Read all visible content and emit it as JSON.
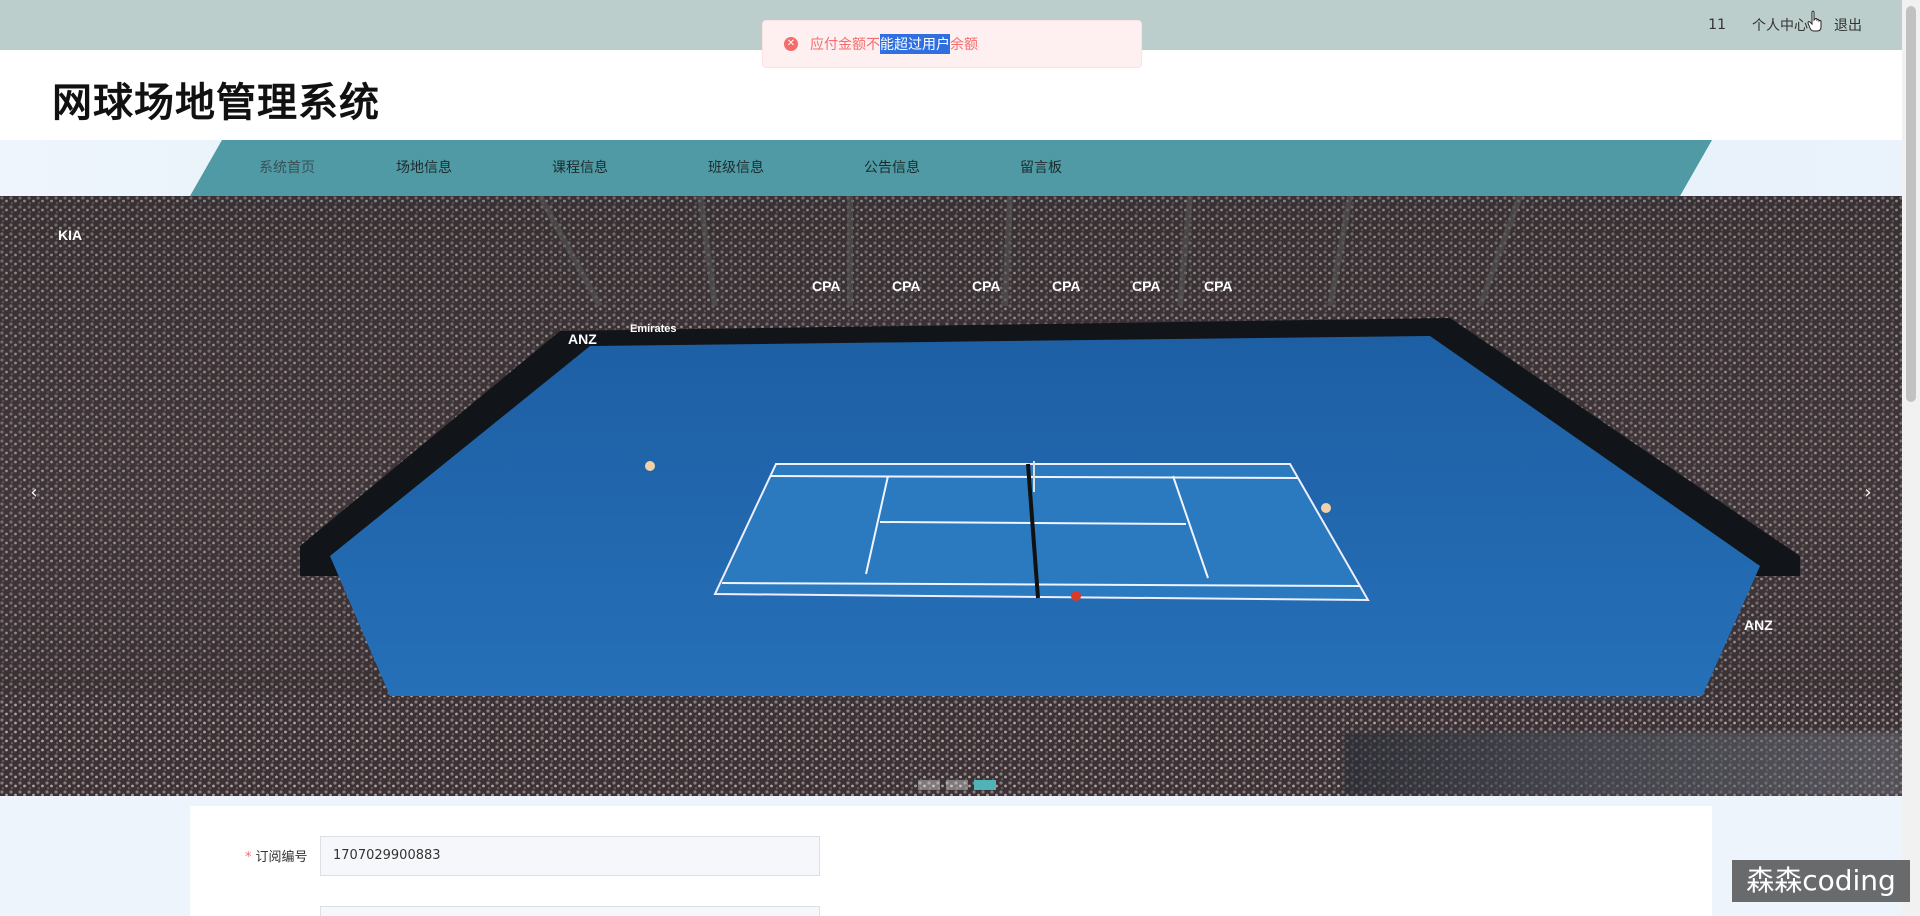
{
  "topbar": {
    "user_id": "11",
    "profile_label": "个人中心",
    "logout_label": "退出"
  },
  "toast": {
    "text_before": "应付金额不",
    "text_selected": "能超过用户",
    "text_after": "余额",
    "icon": "error-circle-icon"
  },
  "header": {
    "title": "网球场地管理系统"
  },
  "nav": {
    "items": [
      {
        "label": "系统首页"
      },
      {
        "label": "场地信息"
      },
      {
        "label": "课程信息"
      },
      {
        "label": "班级信息"
      },
      {
        "label": "公告信息"
      },
      {
        "label": "留言板"
      }
    ],
    "active_index": 0
  },
  "banner": {
    "prev_icon": "chevron-left-icon",
    "next_icon": "chevron-right-icon",
    "slide_count": 3,
    "active_slide": 2,
    "board_texts": [
      "CPA",
      "KIA",
      "ANZ",
      "Emirates"
    ]
  },
  "form": {
    "order_label": "订阅编号",
    "order_value": "1707029900883"
  },
  "watermark": "森森coding",
  "colors": {
    "topbar": "#bccecb",
    "nav_strip": "#4f9aa4",
    "court": "#1f6bb0",
    "toast_text": "#f56c6c"
  }
}
